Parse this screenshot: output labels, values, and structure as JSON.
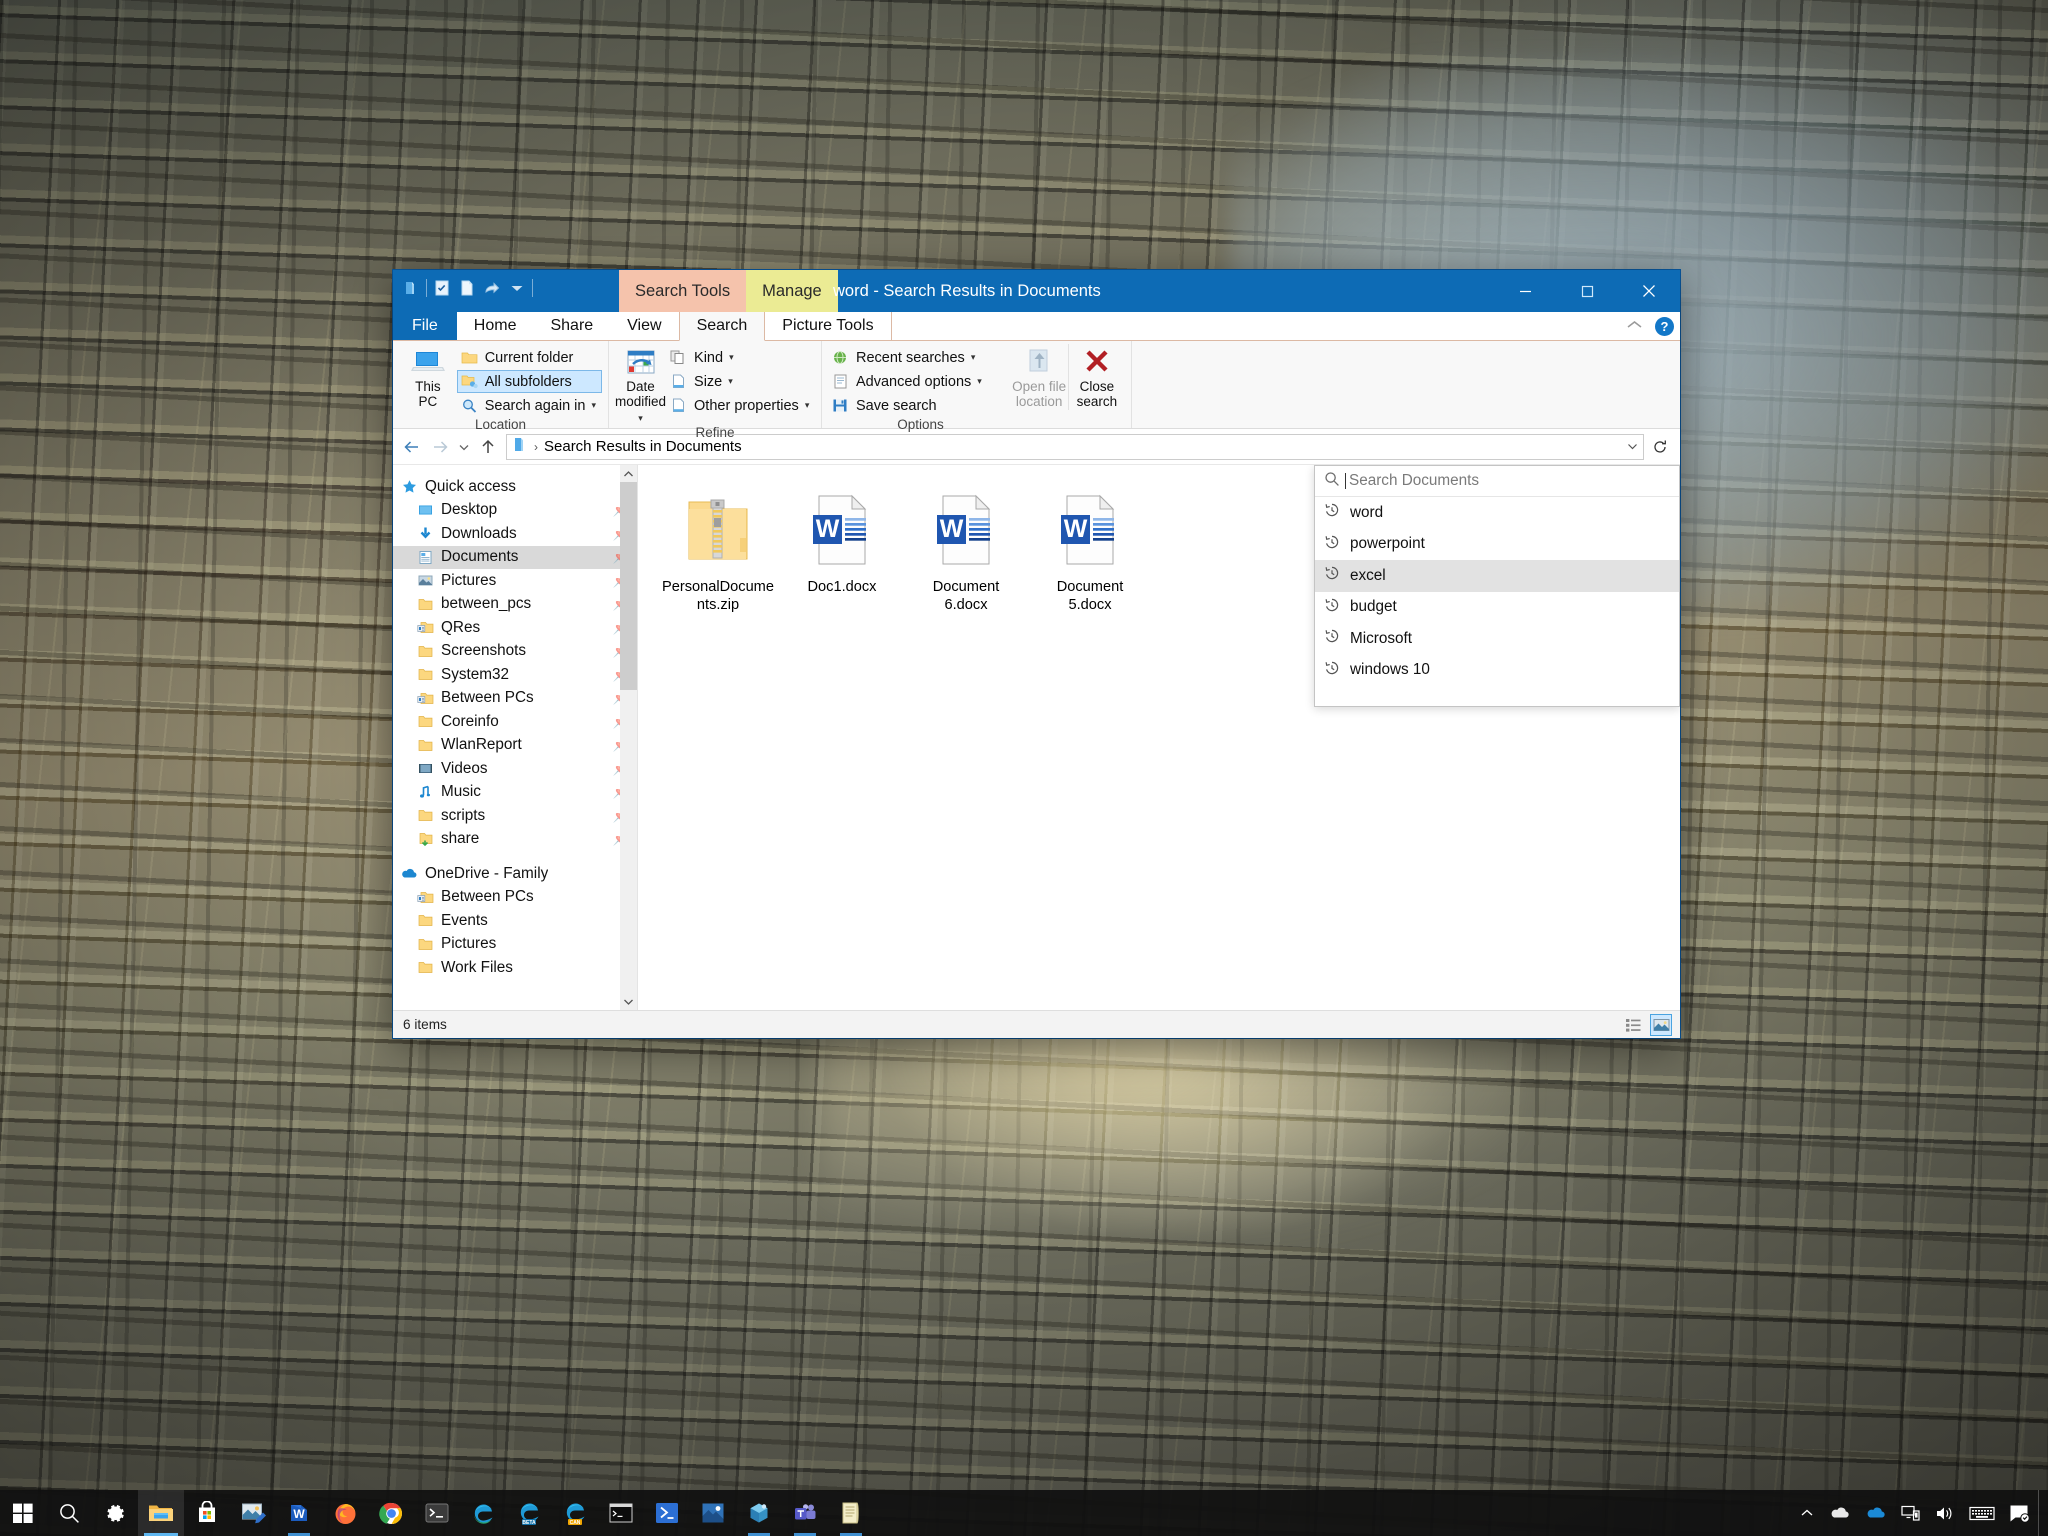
{
  "window": {
    "title": "word - Search Results in Documents",
    "quick_access_toolbar": [
      {
        "name": "explorer-icon",
        "label": "Explorer"
      },
      {
        "name": "properties-icon",
        "label": "Properties"
      },
      {
        "name": "new-folder-icon",
        "label": "New folder"
      },
      {
        "name": "share-icon",
        "label": "Share"
      },
      {
        "name": "customize-caret-icon",
        "label": "Customize Quick Access Toolbar"
      }
    ],
    "controls": {
      "minimize": "—",
      "maximize": "☐",
      "close": "✕"
    }
  },
  "contextual_tabs": [
    {
      "label": "Search Tools",
      "color": "#f5c3ac"
    },
    {
      "label": "Manage",
      "color": "#ebeb94"
    }
  ],
  "ribbon_tabs": [
    {
      "label": "File",
      "kind": "file"
    },
    {
      "label": "Home",
      "kind": "normal"
    },
    {
      "label": "Share",
      "kind": "normal"
    },
    {
      "label": "View",
      "kind": "normal"
    },
    {
      "label": "Search",
      "kind": "active"
    },
    {
      "label": "Picture Tools",
      "kind": "ctxchild"
    }
  ],
  "ribbon": {
    "collapse_icon": "chevron-up-icon",
    "help_label": "?",
    "groups": [
      {
        "label": "Location",
        "big_button": {
          "label_line1": "This",
          "label_line2": "PC",
          "icon": "this-pc-icon",
          "disabled": false
        },
        "small_buttons": [
          {
            "label": "Current folder",
            "icon": "folder-icon",
            "selected": false,
            "caret": false
          },
          {
            "label": "All subfolders",
            "icon": "subfolders-icon",
            "selected": true,
            "caret": false
          },
          {
            "label": "Search again in",
            "icon": "magnifier-icon",
            "selected": false,
            "caret": true
          }
        ]
      },
      {
        "label": "Refine",
        "big_button": {
          "label_line1": "Date",
          "label_line2": "modified",
          "icon": "calendar-icon",
          "disabled": false,
          "caret": true
        },
        "small_buttons": [
          {
            "label": "Kind",
            "icon": "kind-icon",
            "selected": false,
            "caret": true
          },
          {
            "label": "Size",
            "icon": "size-icon",
            "selected": false,
            "caret": true
          },
          {
            "label": "Other properties",
            "icon": "properties-icon",
            "selected": false,
            "caret": true
          }
        ]
      },
      {
        "label": "Options",
        "small_buttons": [
          {
            "label": "Recent searches",
            "icon": "recent-searches-icon",
            "selected": false,
            "caret": true
          },
          {
            "label": "Advanced options",
            "icon": "advanced-options-icon",
            "selected": false,
            "caret": true
          },
          {
            "label": "Save search",
            "icon": "save-icon",
            "selected": false,
            "caret": false
          }
        ],
        "trailing_buttons": [
          {
            "label_line1": "Open file",
            "label_line2": "location",
            "icon": "open-file-location-icon",
            "disabled": true
          },
          {
            "label_line1": "Close",
            "label_line2": "search",
            "icon": "close-search-icon",
            "disabled": false
          }
        ]
      }
    ]
  },
  "address_bar": {
    "back_icon": "back-arrow-icon",
    "forward_icon": "forward-arrow-icon",
    "recent_icon": "chevron-down-icon",
    "up_icon": "up-arrow-icon",
    "breadcrumb_icon": "search-results-icon",
    "path": "Search Results in Documents",
    "dropdown_icon": "chevron-down-icon",
    "refresh_icon": "refresh-icon"
  },
  "nav_pane": {
    "sections": [
      {
        "header": {
          "label": "Quick access",
          "icon": "star-icon"
        },
        "items": [
          {
            "label": "Desktop",
            "icon": "desktop-icon",
            "pinned": true,
            "selected": false
          },
          {
            "label": "Downloads",
            "icon": "downloads-icon",
            "pinned": true,
            "selected": false
          },
          {
            "label": "Documents",
            "icon": "documents-icon",
            "pinned": true,
            "selected": true
          },
          {
            "label": "Pictures",
            "icon": "pictures-icon",
            "pinned": true,
            "selected": false
          },
          {
            "label": "between_pcs",
            "icon": "folder-icon",
            "pinned": true,
            "selected": false
          },
          {
            "label": "QRes",
            "icon": "folder-special-icon",
            "pinned": true,
            "selected": false
          },
          {
            "label": "Screenshots",
            "icon": "folder-icon",
            "pinned": true,
            "selected": false
          },
          {
            "label": "System32",
            "icon": "folder-icon",
            "pinned": true,
            "selected": false
          },
          {
            "label": "Between PCs",
            "icon": "folder-special-icon",
            "pinned": true,
            "selected": false
          },
          {
            "label": "Coreinfo",
            "icon": "folder-icon",
            "pinned": true,
            "selected": false
          },
          {
            "label": "WlanReport",
            "icon": "folder-icon",
            "pinned": true,
            "selected": false
          },
          {
            "label": "Videos",
            "icon": "videos-icon",
            "pinned": true,
            "selected": false
          },
          {
            "label": "Music",
            "icon": "music-icon",
            "pinned": true,
            "selected": false
          },
          {
            "label": "scripts",
            "icon": "folder-icon",
            "pinned": true,
            "selected": false
          },
          {
            "label": "share",
            "icon": "share-folder-icon",
            "pinned": true,
            "selected": false
          }
        ]
      },
      {
        "header": {
          "label": "OneDrive - Family",
          "icon": "onedrive-icon"
        },
        "items": [
          {
            "label": "Between PCs",
            "icon": "folder-special-icon",
            "pinned": false,
            "selected": false
          },
          {
            "label": "Events",
            "icon": "folder-icon",
            "pinned": false,
            "selected": false
          },
          {
            "label": "Pictures",
            "icon": "folder-icon",
            "pinned": false,
            "selected": false
          },
          {
            "label": "Work Files",
            "icon": "folder-icon",
            "pinned": false,
            "selected": false
          }
        ]
      }
    ],
    "scroll_up_icon": "chevron-up-icon",
    "scroll_down_icon": "chevron-down-icon"
  },
  "files": [
    {
      "name": "PersonalDocuments.zip",
      "type": "zip"
    },
    {
      "name": "Doc1.docx",
      "type": "docx"
    },
    {
      "name": "Document 6.docx",
      "type": "docx"
    },
    {
      "name": "Document 5.docx",
      "type": "docx"
    }
  ],
  "search_panel": {
    "placeholder": "Search Documents",
    "search_icon": "search-icon",
    "history": [
      {
        "label": "word",
        "icon": "history-icon",
        "highlighted": false
      },
      {
        "label": "powerpoint",
        "icon": "history-icon",
        "highlighted": false
      },
      {
        "label": "excel",
        "icon": "history-icon",
        "highlighted": true
      },
      {
        "label": "budget",
        "icon": "history-icon",
        "highlighted": false
      },
      {
        "label": "Microsoft",
        "icon": "history-icon",
        "highlighted": false
      },
      {
        "label": "windows 10",
        "icon": "history-icon",
        "highlighted": false
      }
    ]
  },
  "status_bar": {
    "item_count": "6 items",
    "views": [
      {
        "name": "details-view-button",
        "icon": "details-view-icon",
        "active": false
      },
      {
        "name": "large-icons-view-button",
        "icon": "large-icons-view-icon",
        "active": true
      }
    ]
  },
  "taskbar": {
    "items": [
      {
        "name": "start-button",
        "icon": "windows-logo-icon",
        "state": "none"
      },
      {
        "name": "search-button",
        "icon": "search-icon",
        "state": "none"
      },
      {
        "name": "settings-button",
        "icon": "gear-icon",
        "state": "none"
      },
      {
        "name": "file-explorer-button",
        "icon": "folder-icon",
        "state": "active"
      },
      {
        "name": "microsoft-store-button",
        "icon": "store-icon",
        "state": "none"
      },
      {
        "name": "photos-button",
        "icon": "photos-icon",
        "state": "none"
      },
      {
        "name": "word-button",
        "icon": "word-icon",
        "state": "open"
      },
      {
        "name": "firefox-button",
        "icon": "firefox-icon",
        "state": "none"
      },
      {
        "name": "chrome-button",
        "icon": "chrome-icon",
        "state": "none"
      },
      {
        "name": "terminal-button",
        "icon": "terminal-icon",
        "state": "none"
      },
      {
        "name": "edge-button",
        "icon": "edge-icon",
        "state": "none"
      },
      {
        "name": "edge-beta-button",
        "icon": "edge-beta-icon",
        "state": "none"
      },
      {
        "name": "edge-canary-button",
        "icon": "edge-canary-icon",
        "state": "none"
      },
      {
        "name": "command-prompt-button",
        "icon": "console-icon",
        "state": "none"
      },
      {
        "name": "powershell-button",
        "icon": "powershell-icon",
        "state": "none"
      },
      {
        "name": "photo-viewer-button",
        "icon": "picture-icon",
        "state": "none"
      },
      {
        "name": "3d-viewer-button",
        "icon": "3d-viewer-icon",
        "state": "open"
      },
      {
        "name": "teams-button",
        "icon": "teams-icon",
        "state": "open"
      },
      {
        "name": "notepad-button",
        "icon": "notepad-icon",
        "state": "open"
      }
    ],
    "tray": [
      {
        "name": "show-hidden-icons-button",
        "icon": "chevron-up-icon"
      },
      {
        "name": "onedrive-personal-icon",
        "icon": "cloud-white-icon"
      },
      {
        "name": "onedrive-family-icon",
        "icon": "cloud-blue-icon"
      },
      {
        "name": "network-icon",
        "icon": "network-icon"
      },
      {
        "name": "volume-icon",
        "icon": "speaker-icon"
      },
      {
        "name": "touch-keyboard-button",
        "icon": "keyboard-icon"
      },
      {
        "name": "action-center-button",
        "icon": "action-center-icon"
      }
    ]
  }
}
